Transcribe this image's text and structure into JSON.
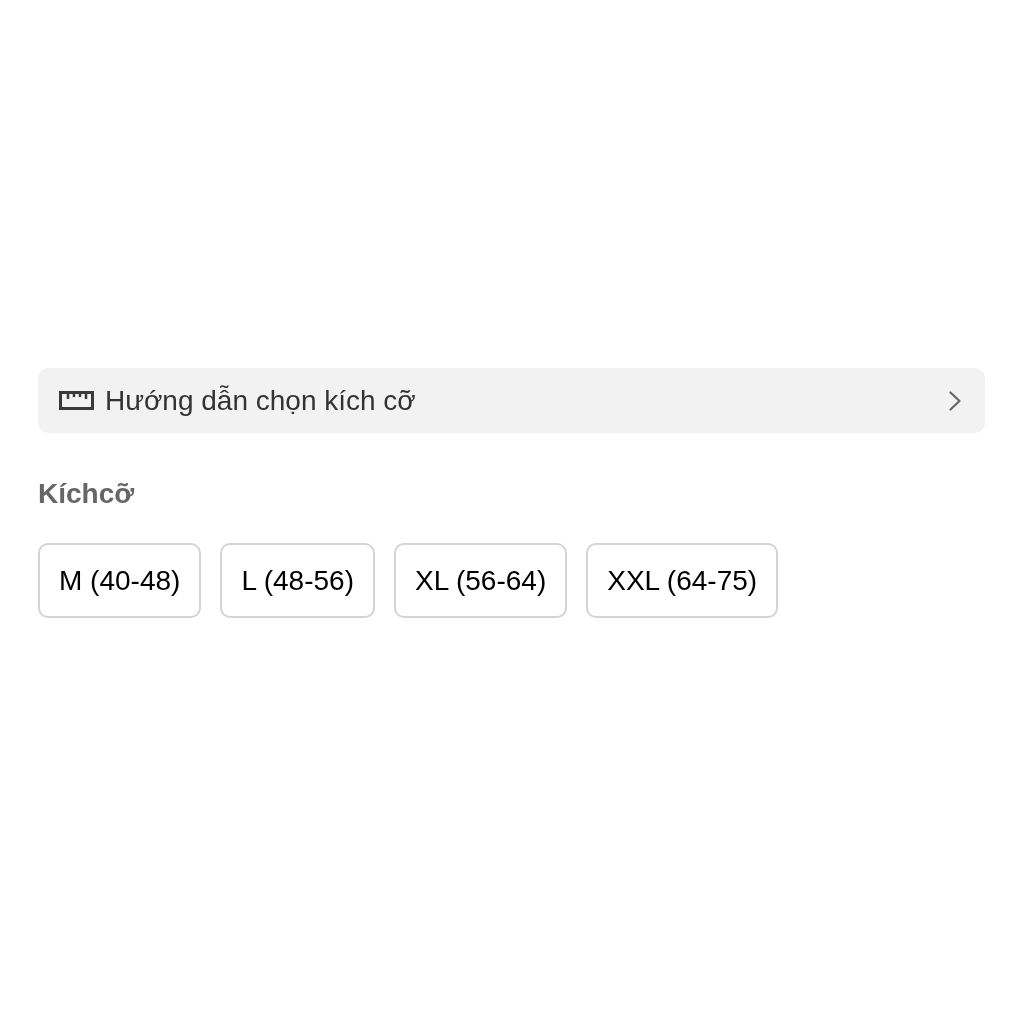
{
  "size_guide": {
    "label": "Hướng dẫn chọn kích cỡ"
  },
  "size_section": {
    "title": "Kíchcỡ",
    "options": [
      {
        "label": "M (40-48)",
        "selected": false
      },
      {
        "label": "L (48-56)",
        "selected": false
      },
      {
        "label": "XL (56-64)",
        "selected": false
      },
      {
        "label": "XXL (64-75)",
        "selected": false
      }
    ]
  }
}
